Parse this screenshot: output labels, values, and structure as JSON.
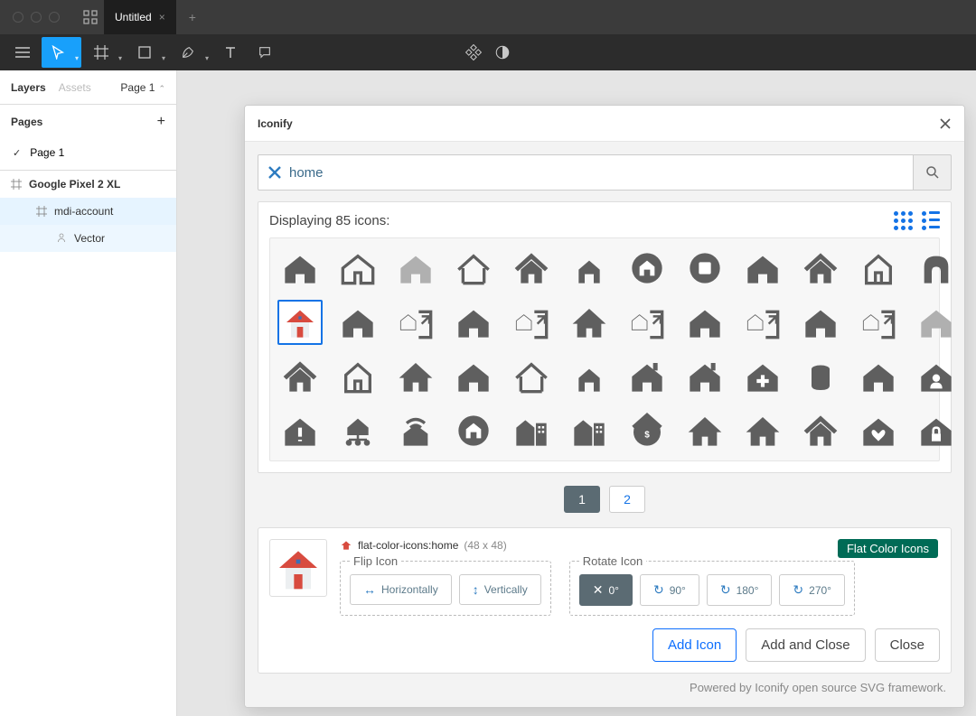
{
  "titlebar": {
    "doc_title": "Untitled"
  },
  "sidebar": {
    "tabs": {
      "layers": "Layers",
      "assets": "Assets"
    },
    "pageSelect": "Page 1",
    "pages_header": "Pages",
    "pages": [
      "Page 1"
    ],
    "layers": [
      {
        "name": "Google Pixel 2 XL"
      },
      {
        "name": "mdi-account"
      },
      {
        "name": "Vector"
      }
    ]
  },
  "panel": {
    "title": "Iconify",
    "search": {
      "value": "home"
    },
    "results_text": "Displaying 85 icons:",
    "pager": {
      "pages": [
        "1",
        "2"
      ],
      "active": "1"
    },
    "detail": {
      "name": "flat-color-icons:home",
      "dims": "(48 x 48)",
      "iconset_label": "Flat Color Icons",
      "flip_label": "Flip Icon",
      "flip_h": "Horizontally",
      "flip_v": "Vertically",
      "rotate_label": "Rotate Icon",
      "rot0": "0°",
      "rot90": "90°",
      "rot180": "180°",
      "rot270": "270°"
    },
    "actions": {
      "add": "Add Icon",
      "addclose": "Add and Close",
      "close": "Close"
    },
    "credit": "Powered by Iconify open source SVG framework."
  },
  "colors": {
    "icon_gray": "#5f5f5f",
    "icon_light": "#b0b0b0",
    "accent": "#18a0fb",
    "teal": "#006b56"
  }
}
